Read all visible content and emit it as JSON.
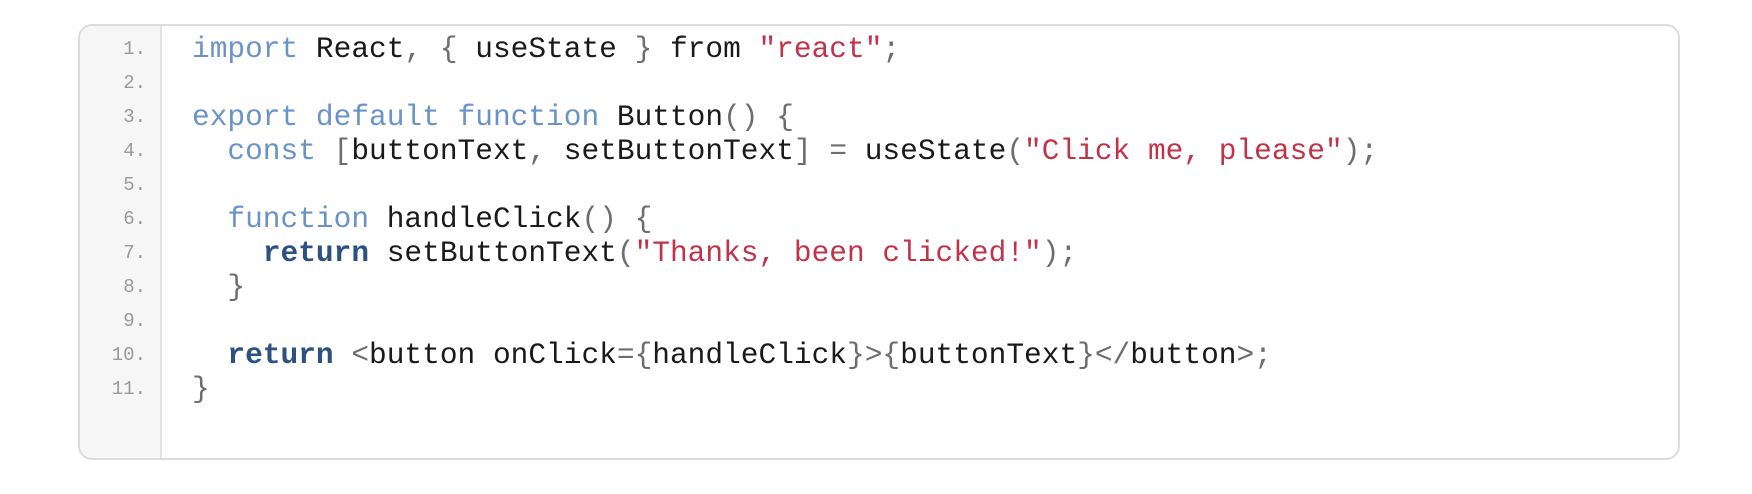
{
  "code": {
    "line_numbers": [
      "1.",
      "2.",
      "3.",
      "4.",
      "5.",
      "6.",
      "7.",
      "8.",
      "9.",
      "10.",
      "11."
    ],
    "lines": [
      [
        {
          "t": "import",
          "c": "kw"
        },
        {
          "t": " React",
          "c": ""
        },
        {
          "t": ",",
          "c": "pun"
        },
        {
          "t": " ",
          "c": ""
        },
        {
          "t": "{",
          "c": "pun"
        },
        {
          "t": " useState ",
          "c": ""
        },
        {
          "t": "}",
          "c": "pun"
        },
        {
          "t": " from ",
          "c": ""
        },
        {
          "t": "\"react\"",
          "c": "str"
        },
        {
          "t": ";",
          "c": "pun"
        }
      ],
      [],
      [
        {
          "t": "export",
          "c": "kw"
        },
        {
          "t": " ",
          "c": ""
        },
        {
          "t": "default",
          "c": "kw"
        },
        {
          "t": " ",
          "c": ""
        },
        {
          "t": "function",
          "c": "kw"
        },
        {
          "t": " Button",
          "c": ""
        },
        {
          "t": "()",
          "c": "pun"
        },
        {
          "t": " ",
          "c": ""
        },
        {
          "t": "{",
          "c": "pun"
        }
      ],
      [
        {
          "t": "  ",
          "c": ""
        },
        {
          "t": "const",
          "c": "kw"
        },
        {
          "t": " ",
          "c": ""
        },
        {
          "t": "[",
          "c": "pun"
        },
        {
          "t": "buttonText",
          "c": ""
        },
        {
          "t": ",",
          "c": "pun"
        },
        {
          "t": " setButtonText",
          "c": ""
        },
        {
          "t": "]",
          "c": "pun"
        },
        {
          "t": " ",
          "c": ""
        },
        {
          "t": "=",
          "c": "pun"
        },
        {
          "t": " useState",
          "c": ""
        },
        {
          "t": "(",
          "c": "pun"
        },
        {
          "t": "\"Click me, please\"",
          "c": "str"
        },
        {
          "t": ");",
          "c": "pun"
        }
      ],
      [],
      [
        {
          "t": "  ",
          "c": ""
        },
        {
          "t": "function",
          "c": "kw"
        },
        {
          "t": " handleClick",
          "c": ""
        },
        {
          "t": "()",
          "c": "pun"
        },
        {
          "t": " ",
          "c": ""
        },
        {
          "t": "{",
          "c": "pun"
        }
      ],
      [
        {
          "t": "    ",
          "c": ""
        },
        {
          "t": "return",
          "c": "kwb"
        },
        {
          "t": " setButtonText",
          "c": ""
        },
        {
          "t": "(",
          "c": "pun"
        },
        {
          "t": "\"Thanks, been clicked!\"",
          "c": "str"
        },
        {
          "t": ");",
          "c": "pun"
        }
      ],
      [
        {
          "t": "  ",
          "c": ""
        },
        {
          "t": "}",
          "c": "pun"
        }
      ],
      [],
      [
        {
          "t": "  ",
          "c": ""
        },
        {
          "t": "return",
          "c": "kwb"
        },
        {
          "t": " ",
          "c": ""
        },
        {
          "t": "<",
          "c": "pun"
        },
        {
          "t": "button onClick",
          "c": ""
        },
        {
          "t": "={",
          "c": "pun"
        },
        {
          "t": "handleClick",
          "c": ""
        },
        {
          "t": "}>{",
          "c": "pun"
        },
        {
          "t": "buttonText",
          "c": ""
        },
        {
          "t": "}</",
          "c": "pun"
        },
        {
          "t": "button",
          "c": ""
        },
        {
          "t": ">;",
          "c": "pun"
        }
      ],
      [
        {
          "t": "}",
          "c": "pun"
        }
      ]
    ]
  },
  "colors": {
    "keyword": "#6a93c8",
    "keyword_bold": "#2c5283",
    "string": "#c0334a",
    "punctuation": "#6d6d6d",
    "text": "#1a1a1a",
    "line_number": "#9a9a9a",
    "gutter_bg": "#f6f6f6",
    "border": "#dcdcdc"
  }
}
